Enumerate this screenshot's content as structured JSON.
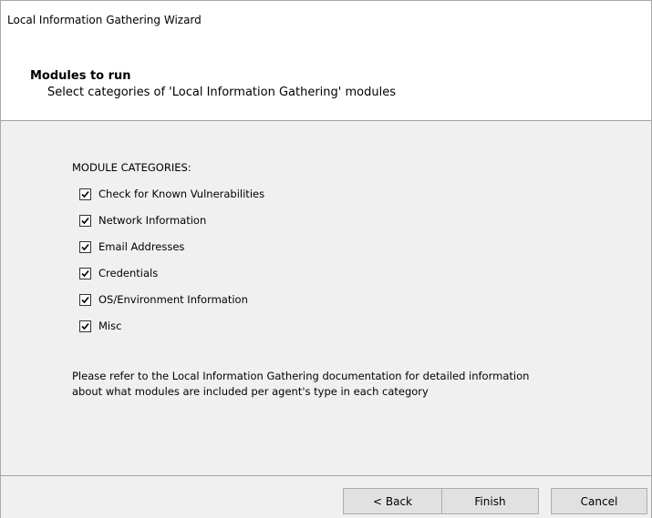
{
  "window": {
    "title": "Local Information Gathering Wizard"
  },
  "header": {
    "title": "Modules to run",
    "subtitle": "Select categories of 'Local Information Gathering' modules"
  },
  "body": {
    "categories_label": "MODULE CATEGORIES:",
    "categories": [
      {
        "label": "Check for Known Vulnerabilities",
        "checked": true
      },
      {
        "label": "Network Information",
        "checked": true
      },
      {
        "label": "Email Addresses",
        "checked": true
      },
      {
        "label": "Credentials",
        "checked": true
      },
      {
        "label": "OS/Environment Information",
        "checked": true
      },
      {
        "label": "Misc",
        "checked": true
      }
    ],
    "note_line1": "Please refer to the Local Information Gathering documentation for detailed information",
    "note_line2": "about what modules are included per agent's type in each category"
  },
  "footer": {
    "back_label": "< Back",
    "finish_label": "Finish",
    "cancel_label": "Cancel"
  },
  "icons": {
    "checkbox": "checkmark-icon"
  }
}
